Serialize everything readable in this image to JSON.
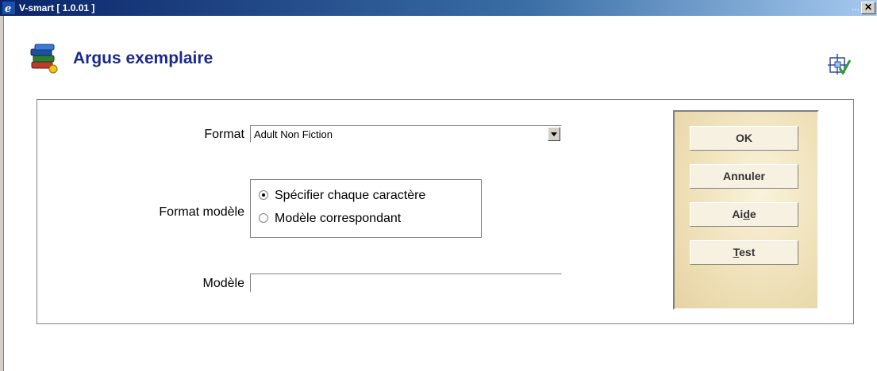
{
  "window": {
    "title": "V-smart [ 1.0.01 ]",
    "dots": "..."
  },
  "page": {
    "title": "Argus exemplaire"
  },
  "form": {
    "format_label": "Format",
    "format_value": "Adult Non Fiction",
    "format_modele_label": "Format modèle",
    "radio_options": [
      "Spécifier chaque caractère",
      "Modèle correspondant"
    ],
    "radio_selected_index": 0,
    "modele_label": "Modèle",
    "modele_value": ""
  },
  "buttons": {
    "ok": "OK",
    "annuler": "Annuler",
    "aide_prefix": "Ai",
    "aide_mnemonic": "d",
    "aide_suffix": "e",
    "test_mnemonic": "T",
    "test_suffix": "est"
  },
  "icons": {
    "window": "ie-icon",
    "app": "books-icon",
    "top_right": "layout-check-icon",
    "close": "close-icon"
  }
}
